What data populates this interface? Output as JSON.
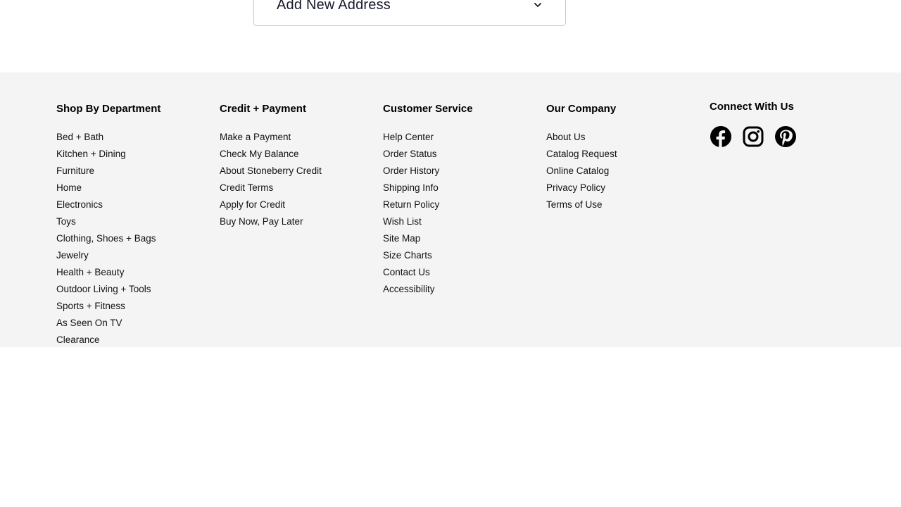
{
  "address": {
    "title": "Add New Address",
    "icon": "chevron-down-icon"
  },
  "footer": {
    "columns": [
      {
        "title": "Shop By Department",
        "links": [
          "Bed + Bath",
          "Kitchen + Dining",
          "Furniture",
          "Home",
          "Electronics",
          "Toys",
          "Clothing, Shoes + Bags",
          "Jewelry",
          "Health + Beauty",
          "Outdoor Living + Tools",
          "Sports + Fitness",
          "As Seen On TV",
          "Clearance"
        ]
      },
      {
        "title": "Credit + Payment",
        "links": [
          "Make a Payment",
          "Check My Balance",
          "About Stoneberry Credit",
          "Credit Terms",
          "Apply for Credit",
          "Buy Now, Pay Later"
        ]
      },
      {
        "title": "Customer Service",
        "links": [
          "Help Center",
          "Order Status",
          "Order History",
          "Shipping Info",
          "Return Policy",
          "Wish List",
          "Site Map",
          "Size Charts",
          "Contact Us",
          "Accessibility"
        ]
      },
      {
        "title": "Our Company",
        "links": [
          "About Us",
          "Catalog Request",
          "Online Catalog",
          "Privacy Policy",
          "Terms of Use"
        ]
      }
    ],
    "connect": {
      "title": "Connect With Us",
      "icons": [
        "facebook-icon",
        "instagram-icon",
        "pinterest-icon"
      ]
    }
  }
}
